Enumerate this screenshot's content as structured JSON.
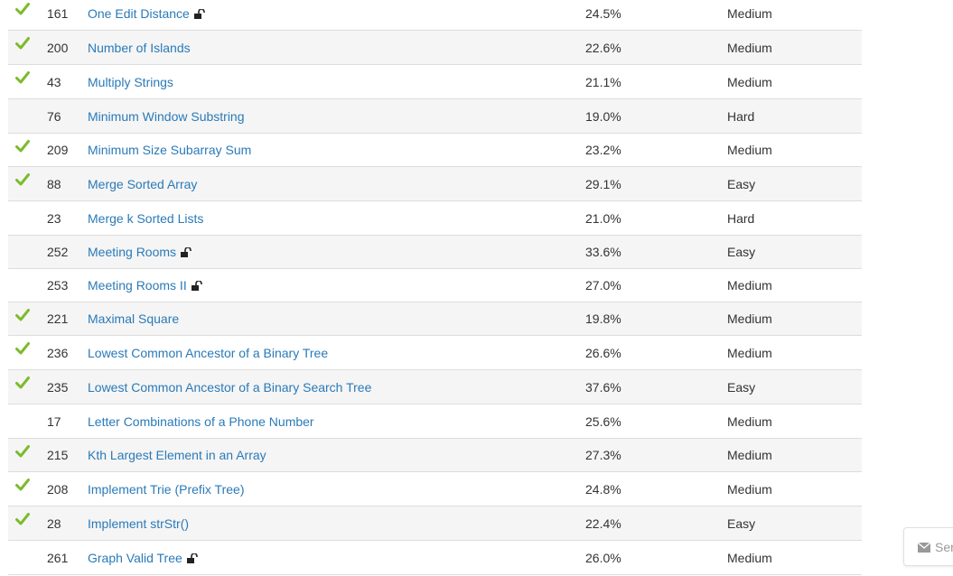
{
  "problems": [
    {
      "solved": true,
      "id": "161",
      "title": "One Edit Distance",
      "locked": true,
      "acceptance": "24.5%",
      "difficulty": "Medium"
    },
    {
      "solved": true,
      "id": "200",
      "title": "Number of Islands",
      "locked": false,
      "acceptance": "22.6%",
      "difficulty": "Medium"
    },
    {
      "solved": true,
      "id": "43",
      "title": "Multiply Strings",
      "locked": false,
      "acceptance": "21.1%",
      "difficulty": "Medium"
    },
    {
      "solved": false,
      "id": "76",
      "title": "Minimum Window Substring",
      "locked": false,
      "acceptance": "19.0%",
      "difficulty": "Hard"
    },
    {
      "solved": true,
      "id": "209",
      "title": "Minimum Size Subarray Sum",
      "locked": false,
      "acceptance": "23.2%",
      "difficulty": "Medium"
    },
    {
      "solved": true,
      "id": "88",
      "title": "Merge Sorted Array",
      "locked": false,
      "acceptance": "29.1%",
      "difficulty": "Easy"
    },
    {
      "solved": false,
      "id": "23",
      "title": "Merge k Sorted Lists",
      "locked": false,
      "acceptance": "21.0%",
      "difficulty": "Hard"
    },
    {
      "solved": false,
      "id": "252",
      "title": "Meeting Rooms",
      "locked": true,
      "acceptance": "33.6%",
      "difficulty": "Easy"
    },
    {
      "solved": false,
      "id": "253",
      "title": "Meeting Rooms II",
      "locked": true,
      "acceptance": "27.0%",
      "difficulty": "Medium"
    },
    {
      "solved": true,
      "id": "221",
      "title": "Maximal Square",
      "locked": false,
      "acceptance": "19.8%",
      "difficulty": "Medium"
    },
    {
      "solved": true,
      "id": "236",
      "title": "Lowest Common Ancestor of a Binary Tree",
      "locked": false,
      "acceptance": "26.6%",
      "difficulty": "Medium"
    },
    {
      "solved": true,
      "id": "235",
      "title": "Lowest Common Ancestor of a Binary Search Tree",
      "locked": false,
      "acceptance": "37.6%",
      "difficulty": "Easy"
    },
    {
      "solved": false,
      "id": "17",
      "title": "Letter Combinations of a Phone Number",
      "locked": false,
      "acceptance": "25.6%",
      "difficulty": "Medium"
    },
    {
      "solved": true,
      "id": "215",
      "title": "Kth Largest Element in an Array",
      "locked": false,
      "acceptance": "27.3%",
      "difficulty": "Medium"
    },
    {
      "solved": true,
      "id": "208",
      "title": "Implement Trie (Prefix Tree)",
      "locked": false,
      "acceptance": "24.8%",
      "difficulty": "Medium"
    },
    {
      "solved": true,
      "id": "28",
      "title": "Implement strStr()",
      "locked": false,
      "acceptance": "22.4%",
      "difficulty": "Easy"
    },
    {
      "solved": false,
      "id": "261",
      "title": "Graph Valid Tree",
      "locked": true,
      "acceptance": "26.0%",
      "difficulty": "Medium"
    }
  ],
  "feedback": {
    "label": "Ser",
    "icon": "envelope-icon"
  },
  "colors": {
    "check": "#7cbb2b",
    "link": "#2a7ab8",
    "stripe": "#f5f5f5",
    "border": "#dddddd"
  }
}
